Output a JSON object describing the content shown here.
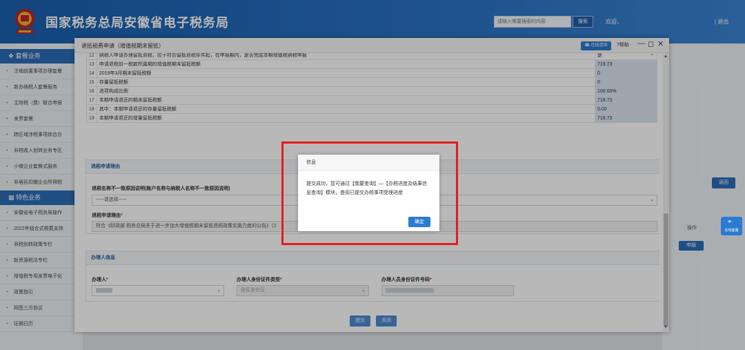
{
  "header": {
    "site_title": "国家税务总局安徽省电子税务局",
    "search_placeholder": "请输入需要搜索的内容",
    "search_button": "搜索",
    "welcome": "欢迎，",
    "logout": "| 退出"
  },
  "sidebar": {
    "section1_title": "套餐业务",
    "items1": [
      "注销前置事项办理套餐",
      "新办纳税人套餐服务",
      "主附税（费）联合申报",
      "发票套餐",
      "跨区域涉税事项综合办",
      "非税收入划转业务专区",
      "小微企业套餐式服务",
      "非居民扣缴企业所得税"
    ],
    "section2_title": "特色业务",
    "items2": [
      "安徽省电子税务局操作",
      "2022年组合式税费支持",
      "非税划转政策专栏",
      "新资源税法专栏",
      "增值税专用发票电子化",
      "政策指引",
      "网签三方协议",
      "征期日历"
    ]
  },
  "right_panel": {
    "back_button": "返回",
    "column_label": "操作",
    "declare_button": "申报",
    "online_service": "在线客服"
  },
  "modal": {
    "title": "退抵税费申请（增值税期末留抵）",
    "online_service_button": "在线咨询",
    "help": "?帮助",
    "rows": [
      {
        "no": "12",
        "label": "纳税人申请办理留抵退税，应于符合留抵退税条件起，在申报期内，是否完成本期增值税纳税申报",
        "value": "是"
      },
      {
        "no": "13",
        "label": "申请退税前一税款所属期的增值税期末留抵税额",
        "value": "719.73"
      },
      {
        "no": "14",
        "label": "2019年3月期末留抵税额",
        "value": "0"
      },
      {
        "no": "15",
        "label": "存量留抵税额",
        "value": "0"
      },
      {
        "no": "16",
        "label": "进项构成比例",
        "value": "100.00%"
      },
      {
        "no": "17",
        "label": "本期申请退还的期末留抵税额",
        "value": "719.73"
      },
      {
        "no": "18",
        "label": "其中：本期申请退还的存量留抵税额",
        "value": "0.00"
      },
      {
        "no": "19",
        "label": "本期申请退还的增量留抵税额",
        "value": "719.73"
      }
    ],
    "reason_section": {
      "title": "退税申请理由",
      "mismatch_label": "退税名称不一致原因说明(账户名称与纳税人名称不一致原因说明)",
      "mismatch_select": "-----请选择-----",
      "reason_label": "退税申请理由",
      "reason_value": "符合《财政部 税务总局关于进一步加大增值税期末留抵退税政策实施力度的公告》（2"
    },
    "handler_section": {
      "title": "办理人信息",
      "handler_label": "办理人",
      "id_type_label": "办理人身份证件类型",
      "id_type_value": "居民身份证",
      "id_no_label": "办理人员身份证件号码"
    },
    "submit_button": "提交",
    "close_button": "关闭"
  },
  "dialog": {
    "title": "信息",
    "message": "提交成功，您可通过【我要查询】—【办税进度及结果信息查询】模块，查阅已提交办税事项受理进度",
    "ok_button": "确定"
  },
  "colors": {
    "brand": "#2a6cb8",
    "highlight": "#e11d1d",
    "button": "#4d8ad3"
  }
}
